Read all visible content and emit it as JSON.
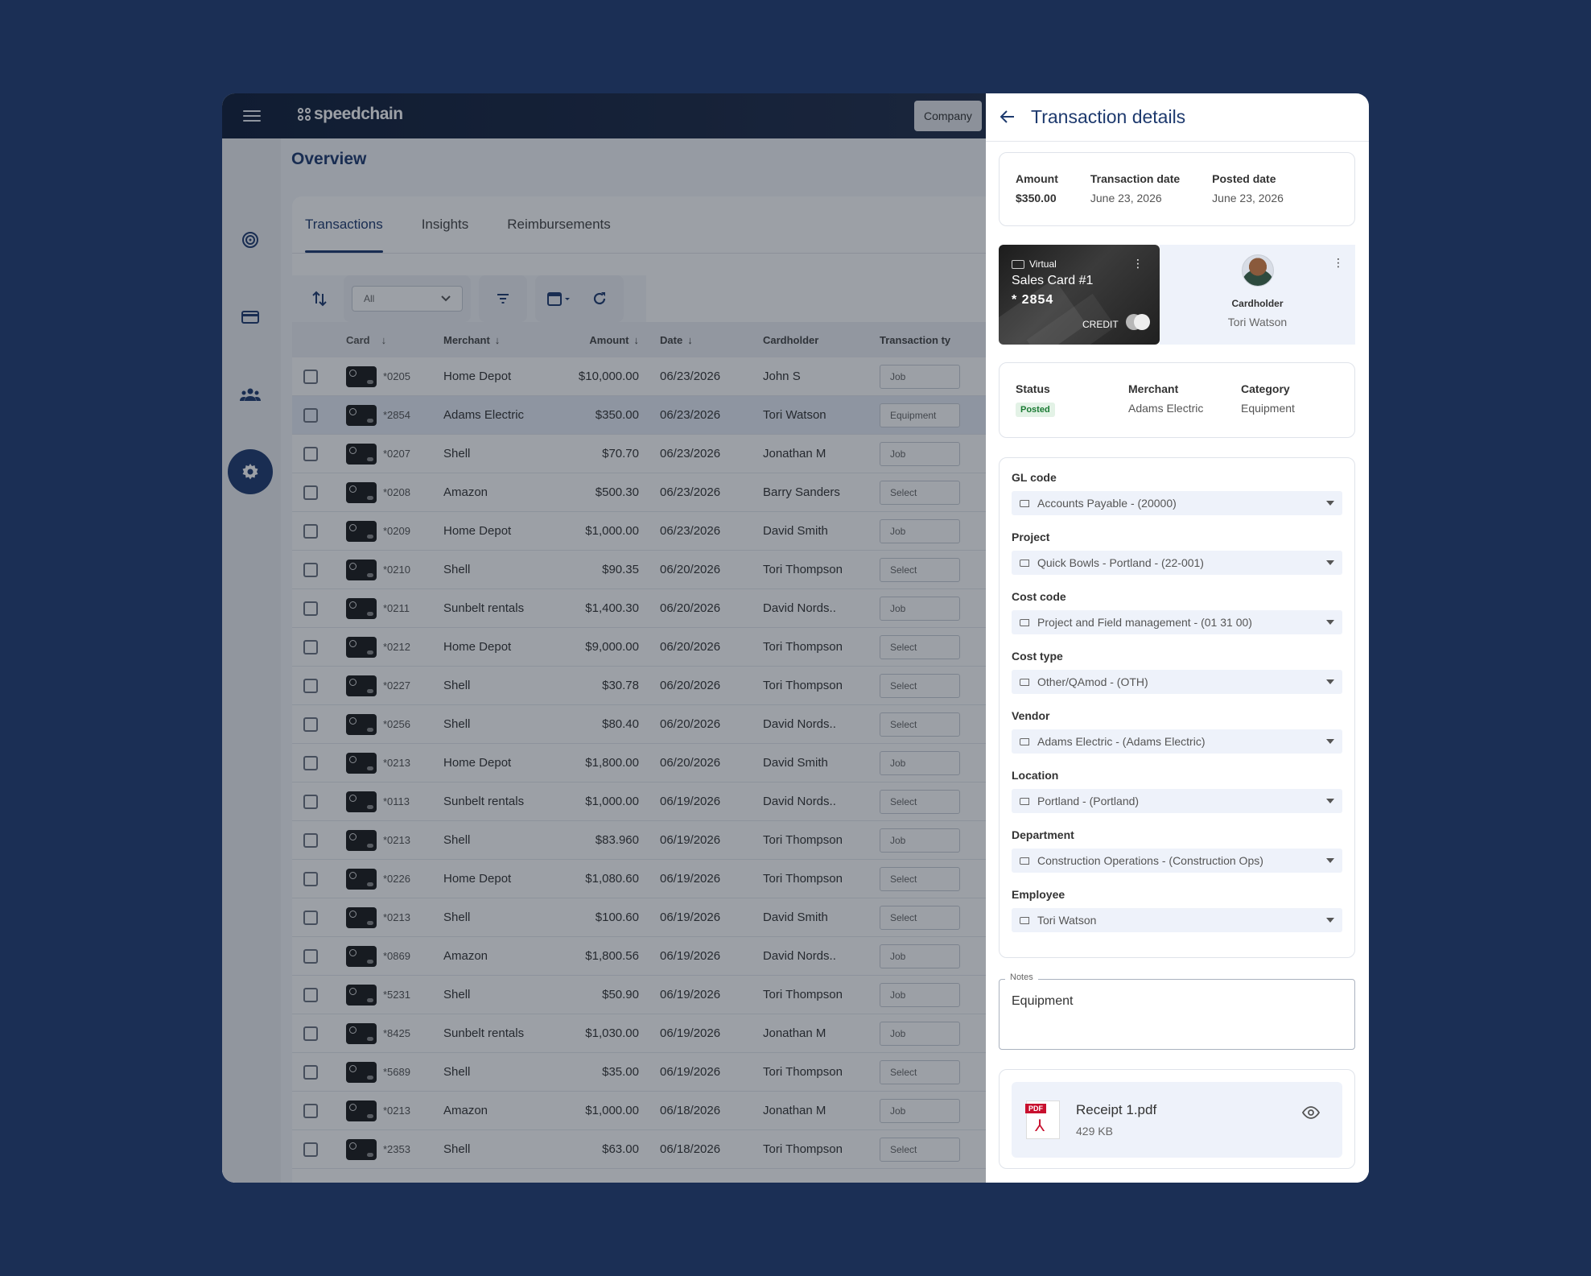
{
  "app": {
    "brand": "speedchain",
    "company_label": "Company",
    "page_title": "Overview"
  },
  "tabs": [
    {
      "label": "Transactions",
      "active": true
    },
    {
      "label": "Insights",
      "active": false
    },
    {
      "label": "Reimbursements",
      "active": false
    }
  ],
  "toolbar": {
    "filter_value": "All"
  },
  "table": {
    "columns": [
      "Card",
      "Merchant",
      "Amount",
      "Date",
      "Cardholder",
      "Transaction ty"
    ],
    "rows": [
      {
        "card": "*0205",
        "merchant": "Home Depot",
        "amount": "$10,000.00",
        "date": "06/23/2026",
        "holder": "John S",
        "type": "Job"
      },
      {
        "card": "*2854",
        "merchant": "Adams Electric",
        "amount": "$350.00",
        "date": "06/23/2026",
        "holder": "Tori Watson",
        "type": "Equipment"
      },
      {
        "card": "*0207",
        "merchant": "Shell",
        "amount": "$70.70",
        "date": "06/23/2026",
        "holder": "Jonathan M",
        "type": "Job"
      },
      {
        "card": "*0208",
        "merchant": "Amazon",
        "amount": "$500.30",
        "date": "06/23/2026",
        "holder": "Barry Sanders",
        "type": "Select"
      },
      {
        "card": "*0209",
        "merchant": "Home Depot",
        "amount": "$1,000.00",
        "date": "06/23/2026",
        "holder": "David Smith",
        "type": "Job"
      },
      {
        "card": "*0210",
        "merchant": "Shell",
        "amount": "$90.35",
        "date": "06/20/2026",
        "holder": "Tori Thompson",
        "type": "Select"
      },
      {
        "card": "*0211",
        "merchant": "Sunbelt rentals",
        "amount": "$1,400.30",
        "date": "06/20/2026",
        "holder": "David Nords..",
        "type": "Job"
      },
      {
        "card": "*0212",
        "merchant": "Home Depot",
        "amount": "$9,000.00",
        "date": "06/20/2026",
        "holder": "Tori Thompson",
        "type": "Select"
      },
      {
        "card": "*0227",
        "merchant": "Shell",
        "amount": "$30.78",
        "date": "06/20/2026",
        "holder": "Tori Thompson",
        "type": "Select"
      },
      {
        "card": "*0256",
        "merchant": "Shell",
        "amount": "$80.40",
        "date": "06/20/2026",
        "holder": "David Nords..",
        "type": "Select"
      },
      {
        "card": "*0213",
        "merchant": "Home Depot",
        "amount": "$1,800.00",
        "date": "06/20/2026",
        "holder": "David Smith",
        "type": "Job"
      },
      {
        "card": "*0113",
        "merchant": "Sunbelt rentals",
        "amount": "$1,000.00",
        "date": "06/19/2026",
        "holder": "David Nords..",
        "type": "Select"
      },
      {
        "card": "*0213",
        "merchant": "Shell",
        "amount": "$83.960",
        "date": "06/19/2026",
        "holder": "Tori Thompson",
        "type": "Job"
      },
      {
        "card": "*0226",
        "merchant": "Home Depot",
        "amount": "$1,080.60",
        "date": "06/19/2026",
        "holder": "Tori Thompson",
        "type": "Select"
      },
      {
        "card": "*0213",
        "merchant": "Shell",
        "amount": "$100.60",
        "date": "06/19/2026",
        "holder": "David Smith",
        "type": "Select"
      },
      {
        "card": "*0869",
        "merchant": "Amazon",
        "amount": "$1,800.56",
        "date": "06/19/2026",
        "holder": "David Nords..",
        "type": "Job"
      },
      {
        "card": "*5231",
        "merchant": "Shell",
        "amount": "$50.90",
        "date": "06/19/2026",
        "holder": "Tori Thompson",
        "type": "Job"
      },
      {
        "card": "*8425",
        "merchant": "Sunbelt rentals",
        "amount": "$1,030.00",
        "date": "06/19/2026",
        "holder": "Jonathan M",
        "type": "Job"
      },
      {
        "card": "*5689",
        "merchant": "Shell",
        "amount": "$35.00",
        "date": "06/19/2026",
        "holder": "Tori Thompson",
        "type": "Select"
      },
      {
        "card": "*0213",
        "merchant": "Amazon",
        "amount": "$1,000.00",
        "date": "06/18/2026",
        "holder": "Jonathan M",
        "type": "Job"
      },
      {
        "card": "*2353",
        "merchant": "Shell",
        "amount": "$63.00",
        "date": "06/18/2026",
        "holder": "Tori Thompson",
        "type": "Select"
      }
    ]
  },
  "panel": {
    "title": "Transaction details",
    "amount_label": "Amount",
    "amount_value": "$350.00",
    "tx_date_label": "Transaction date",
    "tx_date_value": "June 23, 2026",
    "posted_label": "Posted date",
    "posted_value": "June 23, 2026",
    "card": {
      "kind": "Virtual",
      "name": "Sales Card #1",
      "number": "* 2854",
      "credit": "CREDIT"
    },
    "cardholder_label": "Cardholder",
    "cardholder_name": "Tori Watson",
    "status_label": "Status",
    "status_value": "Posted",
    "merchant_label": "Merchant",
    "merchant_value": "Adams Electric",
    "category_label": "Category",
    "category_value": "Equipment",
    "fields": [
      {
        "label": "GL code",
        "value": "Accounts Payable - (20000)"
      },
      {
        "label": "Project",
        "value": "Quick Bowls - Portland - (22-001)"
      },
      {
        "label": "Cost code",
        "value": "Project and Field management - (01 31 00)"
      },
      {
        "label": "Cost type",
        "value": "Other/QAmod - (OTH)"
      },
      {
        "label": "Vendor",
        "value": "Adams Electric - (Adams Electric)"
      },
      {
        "label": "Location",
        "value": "Portland - (Portland)"
      },
      {
        "label": "Department",
        "value": "Construction Operations - (Construction Ops)"
      },
      {
        "label": "Employee",
        "value": "Tori Watson"
      }
    ],
    "notes_label": "Notes",
    "notes_value": "Equipment",
    "receipt_name": "Receipt 1.pdf",
    "receipt_size": "429 KB",
    "pdf_tag": "PDF"
  }
}
